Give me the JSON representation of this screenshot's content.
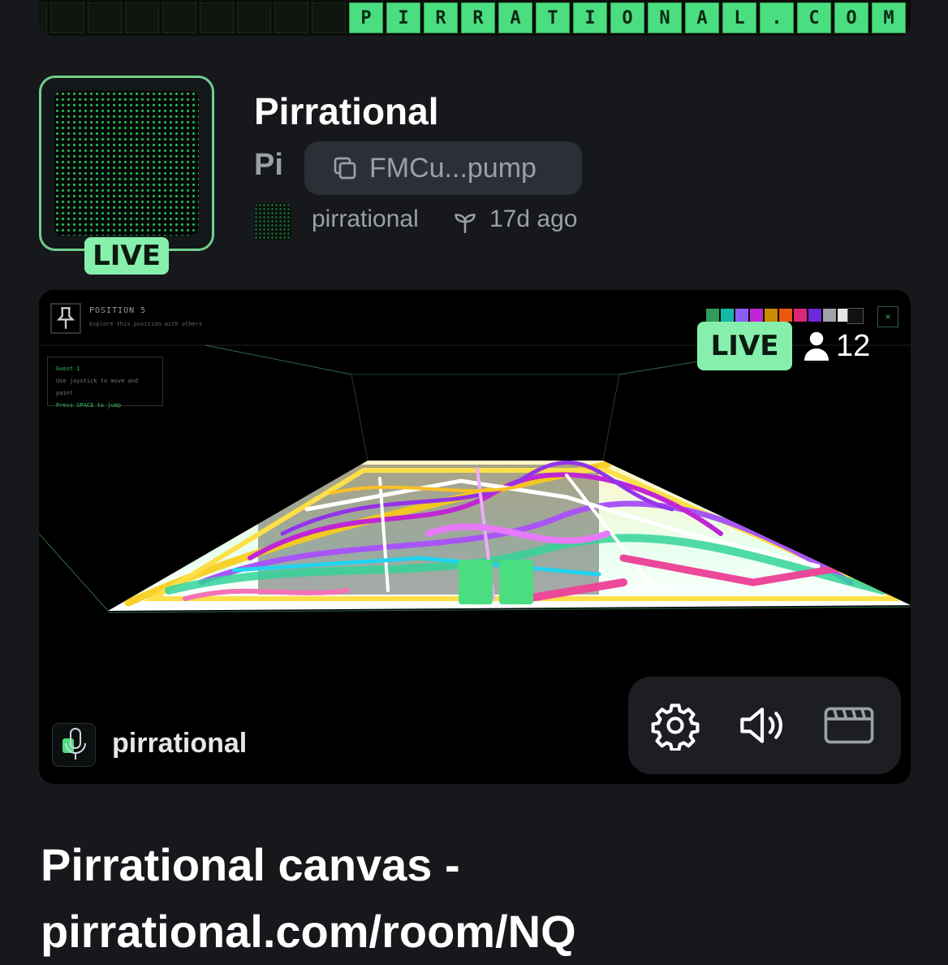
{
  "banner": {
    "letters": [
      "P",
      "I",
      "R",
      "R",
      "A",
      "T",
      "I",
      "O",
      "N",
      "A",
      "L",
      ".",
      "C",
      "O",
      "M"
    ]
  },
  "token": {
    "name": "Pirrational",
    "symbol": "Pi",
    "address_short": "FMCu...pump",
    "live_label": "LIVE",
    "creator": "pirrational",
    "age": "17d ago"
  },
  "stream": {
    "position_title": "POSITION 5",
    "position_subtitle": "Explore this position with others",
    "guest_title": "Guest 1",
    "guest_hint_1": "Use joystick to move and paint",
    "guest_hint_2": "Press SPACE to jump",
    "close_label": "×",
    "palette": [
      "#2f9e5c",
      "#14b8a6",
      "#8b5cf6",
      "#c026d3",
      "#ca8a04",
      "#ea580c",
      "#db2777",
      "#6d28d9",
      "#a1a1aa",
      "#e5e5e5"
    ],
    "live_label": "LIVE",
    "viewer_count": "12",
    "streamer": "pirrational",
    "icons": [
      "gear-icon",
      "volume-icon",
      "theater-icon"
    ]
  },
  "room_title": {
    "line1": "Pirrational canvas -",
    "line2": "pirrational.com/room/NQ"
  },
  "colors": {
    "accent_green": "#86efac",
    "background": "#17181c",
    "muted_text": "#9aa0a6"
  }
}
